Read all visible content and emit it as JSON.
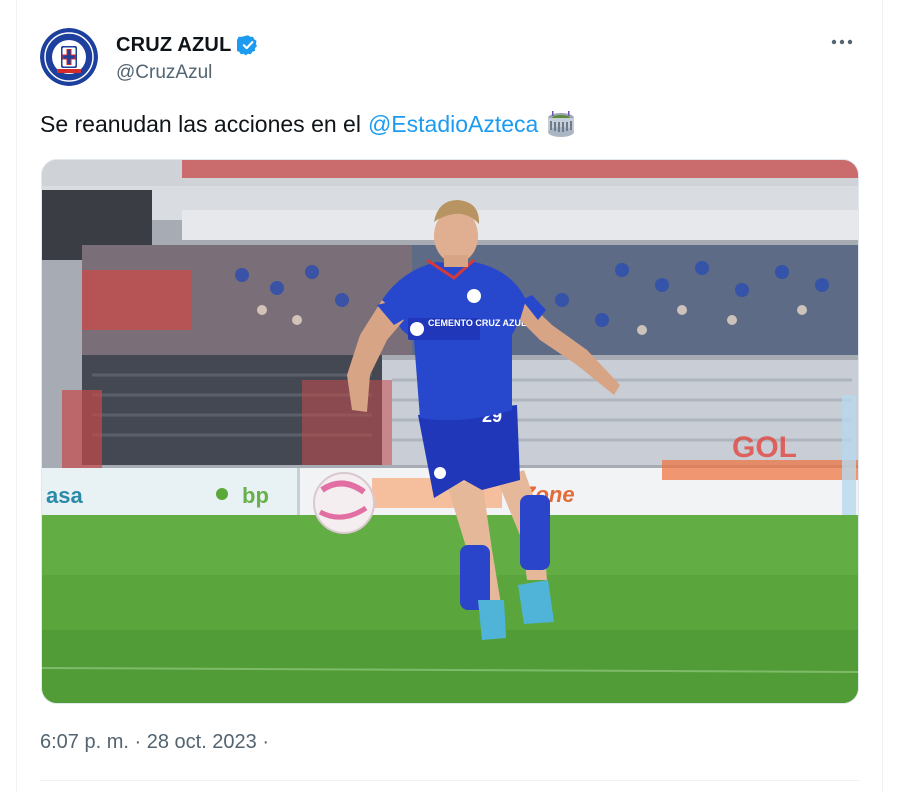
{
  "tweet": {
    "author": {
      "display_name": "CRUZ AZUL",
      "handle": "@CruzAzul",
      "verified": true,
      "avatar_icon": "cruz-azul-crest-icon"
    },
    "text_prefix": "Se reanudan las acciones en el",
    "mention": "@EstadioAzteca",
    "emoji_icon": "stadium-icon",
    "timestamp": "6:07 p. m. · 28 oct. 2023 ·",
    "media": {
      "description_kind": "photo",
      "jersey_sponsor": "CEMENTO CRUZ AZUL",
      "jersey_number": "29",
      "board_texts": [
        "asa",
        "bp",
        "Zone",
        "GOL"
      ]
    }
  },
  "colors": {
    "link": "#1d9bf0",
    "verified": "#1d9bf0",
    "secondary_text": "#536471",
    "primary_text": "#0f1419",
    "club_blue": "#1d3f9e"
  }
}
